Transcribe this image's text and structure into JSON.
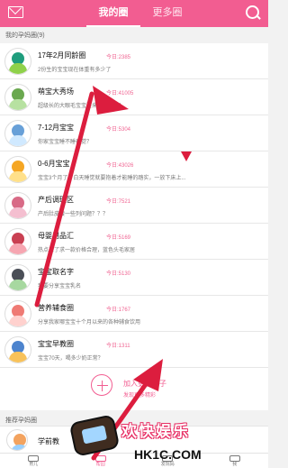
{
  "header": {
    "tabs": [
      {
        "label": "我的圈",
        "active": true
      },
      {
        "label": "更多圈",
        "active": false
      }
    ]
  },
  "my_circles": {
    "title": "我的孕妈圈(9)",
    "items": [
      {
        "name": "17年2月同龄圈",
        "today": "今日:2385",
        "desc": "2份生的宝宝现在体重有多少了",
        "avatar_colors": [
          "#1f9d7d",
          "#8fd14a"
        ]
      },
      {
        "name": "萌宝大秀场",
        "today": "今日:41005",
        "desc": "超级长的大眼毛宝宝要来的接走吧！",
        "avatar_colors": [
          "#6aa84f",
          "#b7e1a1"
        ]
      },
      {
        "name": "7-12月宝宝",
        "today": "今日:5304",
        "desc": "你家宝宝睡不睡夜觉？",
        "avatar_colors": [
          "#68a0d8",
          "#d0e9ff"
        ]
      },
      {
        "name": "0-6月宝宝",
        "today": "今日:43026",
        "desc": "宝宝3个月了，白天睡觉就要抱着才能睡的踏实，一放下床上...",
        "avatar_colors": [
          "#f5a623",
          "#ffe08a"
        ]
      },
      {
        "name": "产后调理区",
        "today": "今日:7521",
        "desc": "产后肚皮腰一些列问题？？？",
        "avatar_colors": [
          "#d86a86",
          "#f4bfd0"
        ]
      },
      {
        "name": "母婴用品汇",
        "today": "今日:5169",
        "desc": "热点来了求一款价格合理，蓝色头毛家居",
        "avatar_colors": [
          "#c94052",
          "#f6a6b1"
        ]
      },
      {
        "name": "宝宝取名字",
        "today": "今日:5130",
        "desc": "我要分享宝宝乳名",
        "avatar_colors": [
          "#4b4f57",
          "#a7d8a0"
        ]
      },
      {
        "name": "营养辅食圈",
        "today": "今日:1767",
        "desc": "分享我家哪宝宝十个月以来的各种辅食饮用",
        "avatar_colors": [
          "#ef7a74",
          "#ffd1ce"
        ]
      },
      {
        "name": "宝宝早教圈",
        "today": "今日:1311",
        "desc": "宝宝70天，喝多少奶正常？",
        "avatar_colors": [
          "#4d84ce",
          "#f8c25a"
        ]
      }
    ]
  },
  "add_circle": {
    "title": "加入更多圈子",
    "subtitle": "发现更多精彩"
  },
  "recommended": {
    "title": "推荐孕妈圈",
    "item_name": "学前教"
  },
  "bottom_nav": [
    {
      "label": "育儿",
      "active": false
    },
    {
      "label": "帮园",
      "active": true
    },
    {
      "label": "发现妈",
      "active": false
    },
    {
      "label": "我",
      "active": false
    }
  ],
  "watermark": {
    "brand": "欢快娱乐",
    "domain": "HK1C.COM"
  },
  "colors": {
    "brand_pink": "#f25d91",
    "today_pink": "#f06693",
    "arrow_red": "#dc1d3e"
  }
}
